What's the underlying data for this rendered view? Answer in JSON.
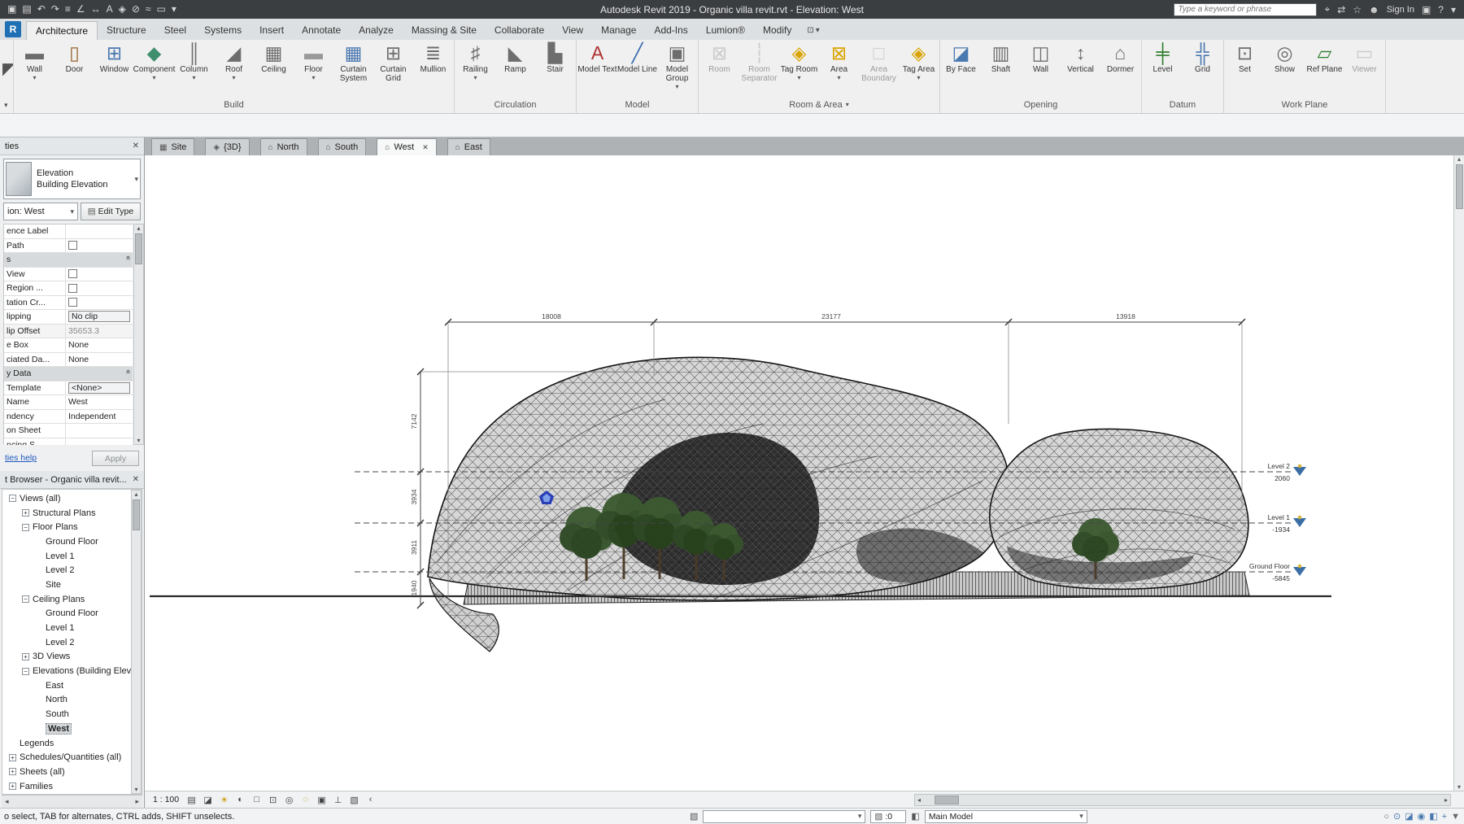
{
  "title_bar": {
    "title": "Autodesk Revit 2019 - Organic villa revit.rvt - Elevation: West",
    "search_placeholder": "Type a keyword or phrase",
    "sign_in_label": "Sign In",
    "qat_icons": [
      "save-icon",
      "open-icon",
      "undo-icon",
      "redo-icon",
      "print-icon",
      "measure-icon",
      "aligned-dimension-icon",
      "text-icon",
      "default-3d-view-icon",
      "section-icon",
      "thin-lines-icon",
      "switch-windows-icon",
      "customize-qat-icon"
    ],
    "right_icons": [
      "search-icon",
      "communication-center-icon",
      "favorites-icon",
      "signin-person-icon",
      "exchange-apps-icon",
      "help-icon",
      "help-dropdown-icon"
    ]
  },
  "ribbon": {
    "tabs": [
      {
        "label": "Architecture",
        "active": true
      },
      {
        "label": "Structure"
      },
      {
        "label": "Steel"
      },
      {
        "label": "Systems"
      },
      {
        "label": "Insert"
      },
      {
        "label": "Annotate"
      },
      {
        "label": "Analyze"
      },
      {
        "label": "Massing & Site"
      },
      {
        "label": "Collaborate"
      },
      {
        "label": "View"
      },
      {
        "label": "Manage"
      },
      {
        "label": "Add-Ins"
      },
      {
        "label": "Lumion®"
      },
      {
        "label": "Modify"
      }
    ],
    "groups": [
      {
        "label": "Build",
        "buttons": [
          {
            "label": "Wall",
            "icon": "wall-icon",
            "dropdown": true
          },
          {
            "label": "Door",
            "icon": "door-icon"
          },
          {
            "label": "Window",
            "icon": "window-icon"
          },
          {
            "label": "Component",
            "icon": "component-icon",
            "dropdown": true
          },
          {
            "label": "Column",
            "icon": "column-icon",
            "dropdown": true
          },
          {
            "label": "Roof",
            "icon": "roof-icon",
            "dropdown": true
          },
          {
            "label": "Ceiling",
            "icon": "ceiling-icon"
          },
          {
            "label": "Floor",
            "icon": "floor-icon",
            "dropdown": true
          },
          {
            "label": "Curtain System",
            "icon": "curtain-system-icon"
          },
          {
            "label": "Curtain Grid",
            "icon": "curtain-grid-icon"
          },
          {
            "label": "Mullion",
            "icon": "mullion-icon"
          }
        ]
      },
      {
        "label": "Circulation",
        "buttons": [
          {
            "label": "Railing",
            "icon": "railing-icon",
            "dropdown": true
          },
          {
            "label": "Ramp",
            "icon": "ramp-icon"
          },
          {
            "label": "Stair",
            "icon": "stair-icon"
          }
        ]
      },
      {
        "label": "Model",
        "buttons": [
          {
            "label": "Model Text",
            "icon": "model-text-icon"
          },
          {
            "label": "Model Line",
            "icon": "model-line-icon"
          },
          {
            "label": "Model Group",
            "icon": "model-group-icon",
            "dropdown": true
          }
        ]
      },
      {
        "label": "Room & Area",
        "caret": true,
        "buttons": [
          {
            "label": "Room",
            "icon": "room-icon",
            "disabled": true
          },
          {
            "label": "Room Separator",
            "icon": "room-separator-icon",
            "disabled": true
          },
          {
            "label": "Tag Room",
            "icon": "tag-room-icon",
            "dropdown": true
          },
          {
            "label": "Area",
            "icon": "area-icon",
            "dropdown": true
          },
          {
            "label": "Area Boundary",
            "icon": "area-boundary-icon",
            "disabled": true
          },
          {
            "label": "Tag Area",
            "icon": "tag-area-icon",
            "dropdown": true
          }
        ]
      },
      {
        "label": "Opening",
        "buttons": [
          {
            "label": "By Face",
            "icon": "by-face-icon"
          },
          {
            "label": "Shaft",
            "icon": "shaft-icon"
          },
          {
            "label": "Wall",
            "icon": "wall-opening-icon"
          },
          {
            "label": "Vertical",
            "icon": "vertical-opening-icon"
          },
          {
            "label": "Dormer",
            "icon": "dormer-icon"
          }
        ]
      },
      {
        "label": "Datum",
        "buttons": [
          {
            "label": "Level",
            "icon": "level-icon"
          },
          {
            "label": "Grid",
            "icon": "grid-icon"
          }
        ]
      },
      {
        "label": "Work Plane",
        "buttons": [
          {
            "label": "Set",
            "icon": "set-plane-icon"
          },
          {
            "label": "Show",
            "icon": "show-plane-icon"
          },
          {
            "label": "Ref Plane",
            "icon": "ref-plane-icon"
          },
          {
            "label": "Viewer",
            "icon": "viewer-icon",
            "disabled": true
          }
        ]
      }
    ]
  },
  "view_tabs": [
    {
      "label": "Site",
      "icon": "plan-view-icon"
    },
    {
      "label": "{3D}",
      "icon": "view-3d-icon"
    },
    {
      "label": "North",
      "icon": "elevation-view-icon"
    },
    {
      "label": "South",
      "icon": "elevation-view-icon"
    },
    {
      "label": "West",
      "icon": "elevation-view-icon",
      "active": true,
      "closable": true
    },
    {
      "label": "East",
      "icon": "elevation-view-icon"
    }
  ],
  "properties_panel": {
    "header": "ties",
    "type_selector": {
      "family": "Elevation",
      "type": "Building Elevation"
    },
    "instance_combo": "ion: West",
    "edit_type_label": "Edit Type",
    "rows": [
      {
        "label": "ence Label",
        "value": "",
        "kind": "text"
      },
      {
        "label": "Path",
        "kind": "check"
      },
      {
        "label": "s",
        "kind": "section"
      },
      {
        "label": "View",
        "kind": "check"
      },
      {
        "label": "Region ...",
        "kind": "check"
      },
      {
        "label": "tation Cr...",
        "kind": "check"
      },
      {
        "label": "lipping",
        "value": "No clip",
        "kind": "button"
      },
      {
        "label": "lip Offset",
        "value": "35653.3",
        "kind": "disabled"
      },
      {
        "label": "e Box",
        "value": "None",
        "kind": "text"
      },
      {
        "label": "ciated Da...",
        "value": "None",
        "kind": "text"
      },
      {
        "label": "y Data",
        "kind": "section"
      },
      {
        "label": "Template",
        "value": "<None>",
        "kind": "button"
      },
      {
        "label": "Name",
        "value": "West",
        "kind": "text"
      },
      {
        "label": "ndency",
        "value": "Independent",
        "kind": "text"
      },
      {
        "label": "on Sheet",
        "value": "",
        "kind": "text"
      },
      {
        "label": "ncing S",
        "value": "",
        "kind": "text"
      }
    ],
    "help_link": "ties help",
    "apply_label": "Apply"
  },
  "project_browser": {
    "header": "t Browser - Organic villa revit...",
    "tree": [
      {
        "label": "Views (all)",
        "indent": 0,
        "exp": "minus"
      },
      {
        "label": "Structural Plans",
        "indent": 1,
        "exp": "plus"
      },
      {
        "label": "Floor Plans",
        "indent": 1,
        "exp": "minus"
      },
      {
        "label": "Ground Floor",
        "indent": 2,
        "exp": "none"
      },
      {
        "label": "Level 1",
        "indent": 2,
        "exp": "none"
      },
      {
        "label": "Level 2",
        "indent": 2,
        "exp": "none"
      },
      {
        "label": "Site",
        "indent": 2,
        "exp": "none"
      },
      {
        "label": "Ceiling Plans",
        "indent": 1,
        "exp": "minus"
      },
      {
        "label": "Ground Floor",
        "indent": 2,
        "exp": "none"
      },
      {
        "label": "Level 1",
        "indent": 2,
        "exp": "none"
      },
      {
        "label": "Level 2",
        "indent": 2,
        "exp": "none"
      },
      {
        "label": "3D Views",
        "indent": 1,
        "exp": "plus"
      },
      {
        "label": "Elevations (Building Elevation",
        "indent": 1,
        "exp": "minus"
      },
      {
        "label": "East",
        "indent": 2,
        "exp": "none"
      },
      {
        "label": "North",
        "indent": 2,
        "exp": "none"
      },
      {
        "label": "South",
        "indent": 2,
        "exp": "none"
      },
      {
        "label": "West",
        "indent": 2,
        "exp": "none",
        "selected": true
      },
      {
        "label": "Legends",
        "indent": 0,
        "exp": "none"
      },
      {
        "label": "Schedules/Quantities (all)",
        "indent": 0,
        "exp": "plus"
      },
      {
        "label": "Sheets (all)",
        "indent": 0,
        "exp": "plus"
      },
      {
        "label": "Families",
        "indent": 0,
        "exp": "plus"
      }
    ]
  },
  "canvas": {
    "levels": [
      {
        "name": "Level 2",
        "elevation": "2060"
      },
      {
        "name": "Level 1",
        "elevation": "-1934"
      },
      {
        "name": "Ground Floor",
        "elevation": "-5845"
      }
    ],
    "top_dimensions": [
      "18008",
      "23177",
      "13918"
    ],
    "left_dimensions": [
      "7142",
      "3934",
      "3911",
      "1940"
    ]
  },
  "view_control_bar": {
    "scale": "1 : 100",
    "icons": [
      "detail-level-icon",
      "visual-style-icon",
      "sun-path-icon",
      "shadows-icon",
      "crop-view-icon",
      "show-crop-region-icon",
      "temporary-hide-isolate-icon",
      "reveal-hidden-elements-icon",
      "temporary-view-properties-icon",
      "show-constraints-icon",
      "worksharing-display-icon",
      "collapse-icon"
    ]
  },
  "status_bar": {
    "hint": "o select, TAB for alternates, CTRL adds, SHIFT unselects.",
    "workset_value": "",
    "editable_value": ":0",
    "design_option": "Main Model",
    "right_icons": [
      "background-processes-icon",
      "select-link-icon",
      "select-underlay-icon",
      "select-pinned-icon",
      "select-by-face-icon",
      "drag-select-icon",
      "filter-icon"
    ]
  }
}
